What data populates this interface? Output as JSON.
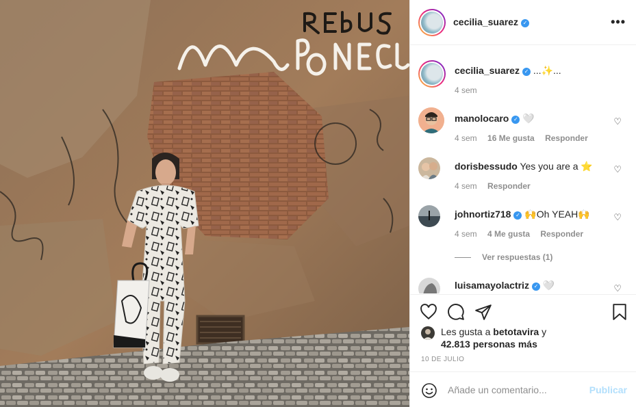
{
  "post": {
    "author": "cecilia_suarez",
    "photo_alt": "",
    "caption": {
      "user": "cecilia_suarez",
      "text": "...✨...",
      "time": "4 sem"
    }
  },
  "comments": [
    {
      "user": "manolocaro",
      "verified": true,
      "text": "🤍",
      "time": "4 sem",
      "likes": "16 Me gusta",
      "reply": "Responder"
    },
    {
      "user": "dorisbessudo",
      "verified": false,
      "text": "Yes you are a ⭐",
      "time": "4 sem",
      "reply": "Responder"
    },
    {
      "user": "johnortiz718",
      "verified": true,
      "text": "🙌Oh YEAH🙌",
      "time": "4 sem",
      "likes": "4 Me gusta",
      "reply": "Responder",
      "view_replies": "Ver respuestas (1)"
    },
    {
      "user": "luisamayolactriz",
      "verified": true,
      "text": "🤍"
    }
  ],
  "engagement": {
    "likes_prefix": "Les gusta a",
    "liked_by": "betotavira",
    "likes_suffix_1": "y",
    "likes_count": "42.813 personas más",
    "date": "10 DE JULIO"
  },
  "add_comment": {
    "placeholder": "Añade un comentario...",
    "post_label": "Publicar"
  },
  "icons": {
    "more": "more-options-icon",
    "heart": "heart-icon",
    "comment": "comment-icon",
    "share": "share-icon",
    "bookmark": "bookmark-icon",
    "emoji": "emoji-icon"
  },
  "colors": {
    "verified": "#3897f0",
    "muted": "#8e8e8e",
    "post_button_disabled": "#b2dffc"
  }
}
